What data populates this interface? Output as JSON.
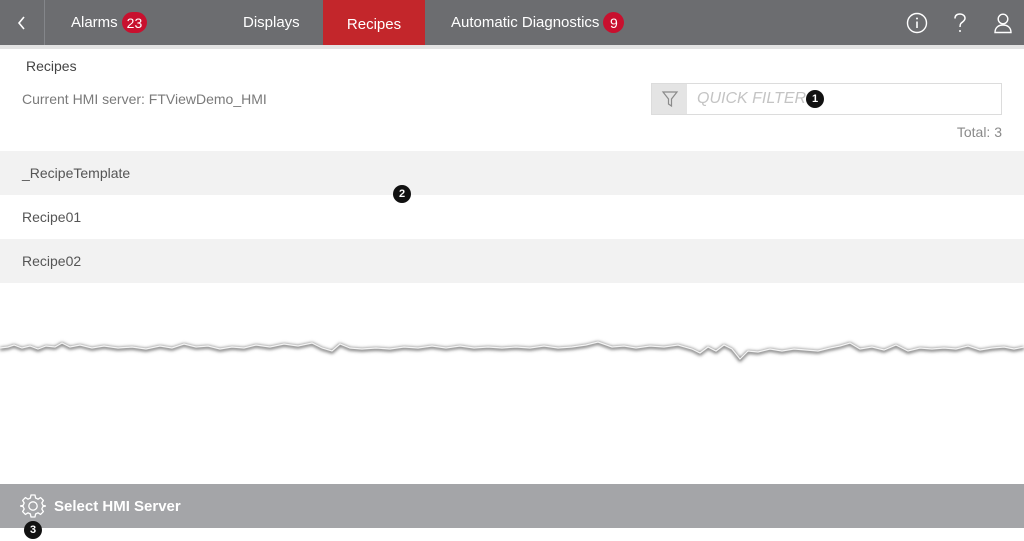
{
  "nav": {
    "tabs": [
      {
        "label": "Alarms",
        "badge": "23"
      },
      {
        "label": "Displays"
      },
      {
        "label": "Recipes",
        "active": true
      },
      {
        "label": "Automatic Diagnostics",
        "badge": "9"
      }
    ],
    "icons": [
      "back-chevron-icon",
      "info-icon",
      "help-icon",
      "user-icon"
    ]
  },
  "page": {
    "title": "Recipes",
    "server": "Current HMI server: FTViewDemo_HMI",
    "filter_placeholder": "QUICK FILTER",
    "total": "Total: 3"
  },
  "recipes": [
    "_RecipeTemplate",
    "Recipe01",
    "Recipe02"
  ],
  "footer": {
    "label": "Select HMI Server",
    "icon": "gear-icon"
  },
  "callouts": [
    "1",
    "2",
    "3"
  ],
  "colors": {
    "nav_bg": "#6c6d70",
    "active_tab": "#c3262b",
    "badge": "#c8102e",
    "footer_bg": "#a4a5a8"
  }
}
